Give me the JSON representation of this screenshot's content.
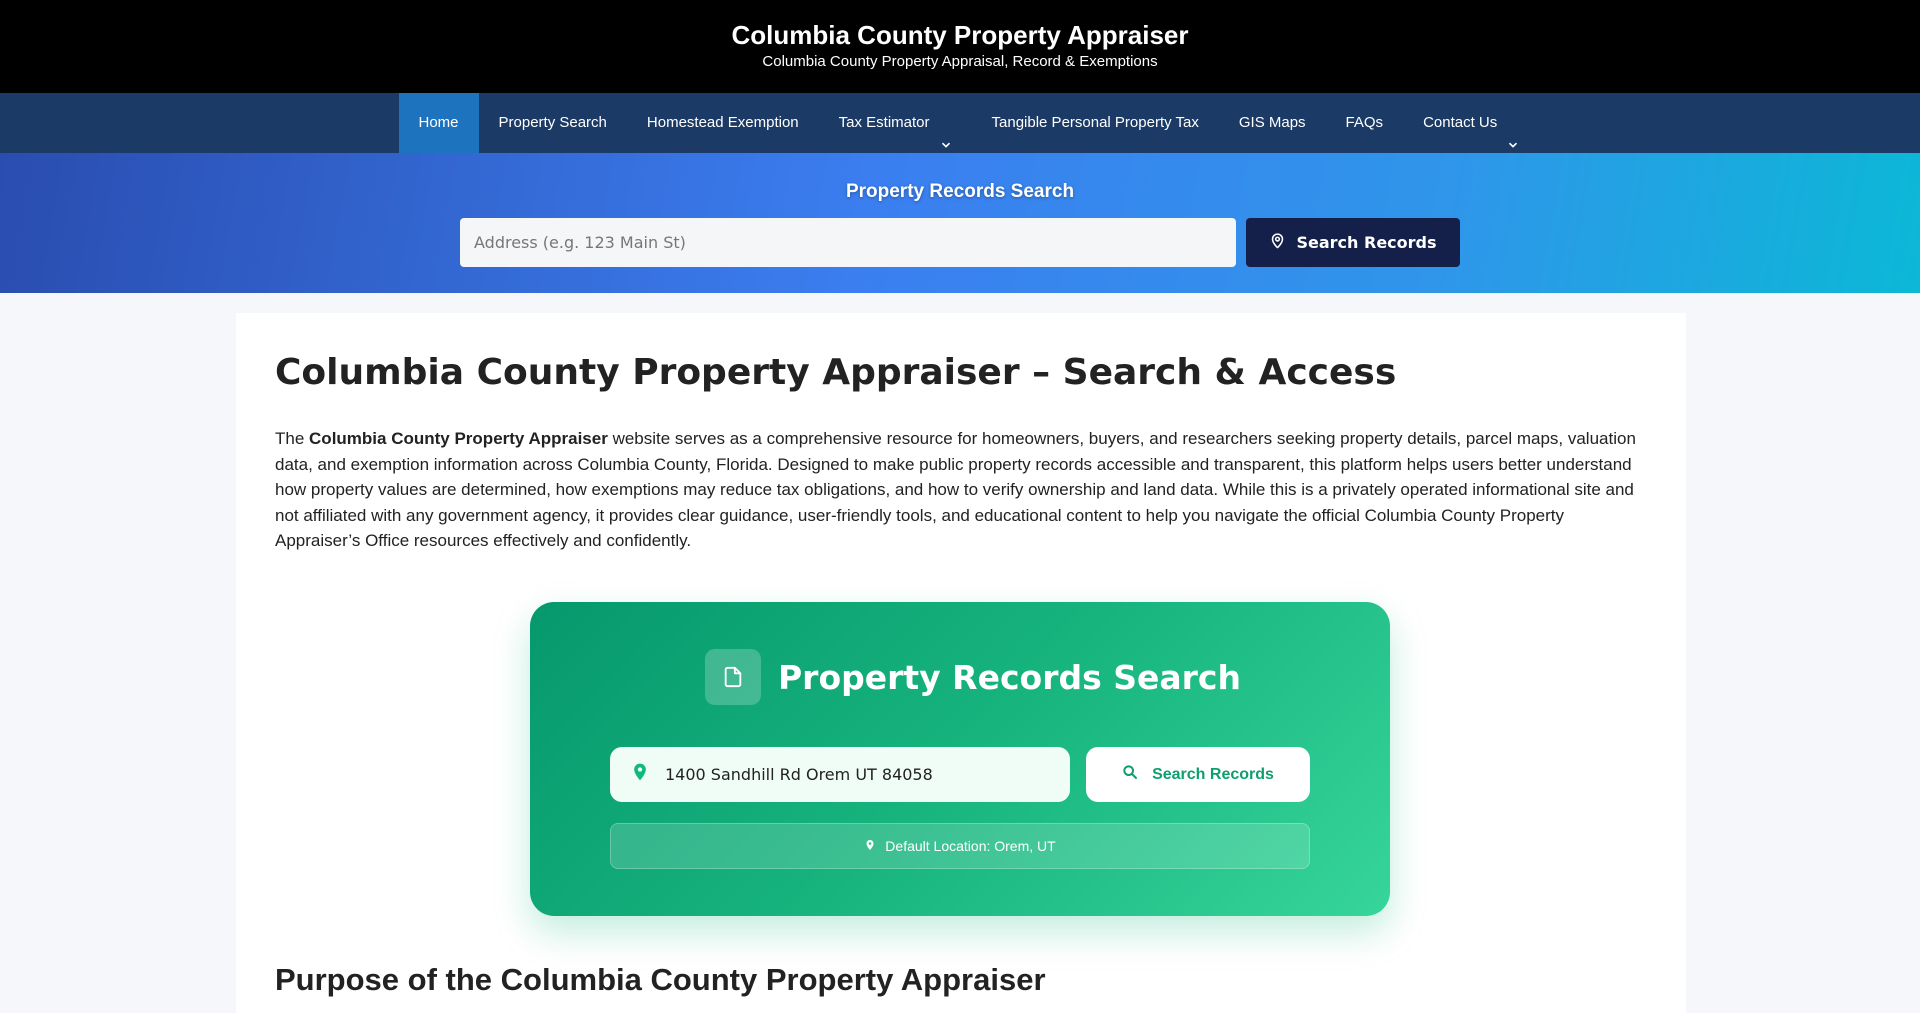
{
  "header": {
    "title": "Columbia County Property Appraiser",
    "tagline": "Columbia County Property Appraisal, Record & Exemptions"
  },
  "nav": {
    "items": [
      {
        "label": "Home",
        "active": true,
        "dropdown": false
      },
      {
        "label": "Property Search",
        "active": false,
        "dropdown": false
      },
      {
        "label": "Homestead Exemption",
        "active": false,
        "dropdown": false
      },
      {
        "label": "Tax Estimator",
        "active": false,
        "dropdown": true
      },
      {
        "label": "Tangible Personal Property Tax",
        "active": false,
        "dropdown": false
      },
      {
        "label": "GIS Maps",
        "active": false,
        "dropdown": false
      },
      {
        "label": "FAQs",
        "active": false,
        "dropdown": false
      },
      {
        "label": "Contact Us",
        "active": false,
        "dropdown": true
      }
    ]
  },
  "hero": {
    "title": "Property Records Search",
    "input_placeholder": "Address (e.g. 123 Main St)",
    "button_label": "Search Records",
    "button_icon": "map-pin-icon"
  },
  "main": {
    "heading": "Columbia County Property Appraiser – Search & Access",
    "intro_prefix": "The ",
    "intro_bold": "Columbia County Property Appraiser",
    "intro_rest": " website serves as a comprehensive resource for homeowners, buyers, and researchers seeking property details, parcel maps, valuation data, and exemption information across Columbia County, Florida. Designed to make public property records accessible and transparent, this platform helps users better understand how property values are determined, how exemptions may reduce tax obligations, and how to verify ownership and land data. While this is a privately operated informational site and not affiliated with any government agency, it provides clear guidance, user-friendly tools, and educational content to help you navigate the official Columbia County Property Appraiser’s Office resources effectively and confidently.",
    "section2_heading": "Purpose of the Columbia County Property Appraiser"
  },
  "search_card": {
    "title": "Property Records Search",
    "title_icon": "document-icon",
    "input_value": "1400 Sandhill Rd Orem UT 84058",
    "input_icon": "map-pin-icon",
    "button_label": "Search Records",
    "button_icon": "search-icon",
    "default_location": "Default Location: Orem, UT",
    "default_icon": "map-pin-icon"
  },
  "colors": {
    "topbar": "#000000",
    "nav": "#1b3a66",
    "nav_active": "#1e73be",
    "hero_button": "#14204a",
    "card_green": "#10b981"
  }
}
